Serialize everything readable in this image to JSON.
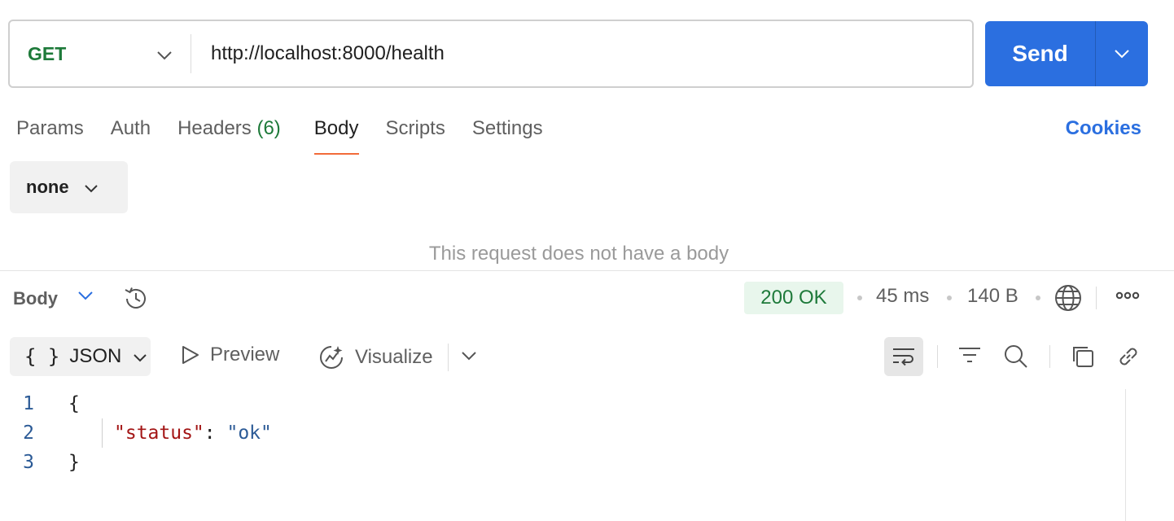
{
  "request": {
    "method": "GET",
    "url": "http://localhost:8000/health",
    "send_label": "Send"
  },
  "request_tabs": [
    {
      "label": "Params"
    },
    {
      "label": "Auth"
    },
    {
      "label": "Headers",
      "count": "(6)"
    },
    {
      "label": "Body"
    },
    {
      "label": "Scripts"
    },
    {
      "label": "Settings"
    }
  ],
  "active_request_tab": "Body",
  "cookies_label": "Cookies",
  "body_mode": "none",
  "empty_body_message": "This request does not have a body",
  "response": {
    "section_label": "Body",
    "status": "200 OK",
    "time": "45 ms",
    "size": "140 B",
    "format": "JSON",
    "format_icon": "{ }",
    "preview_label": "Preview",
    "visualize_label": "Visualize",
    "lines": [
      {
        "num": "1",
        "text": "{"
      },
      {
        "num": "2",
        "key": "\"status\"",
        "sep": ": ",
        "value": "\"ok\""
      },
      {
        "num": "3",
        "text": "}"
      }
    ]
  },
  "colors": {
    "accent": "#2b6fe0",
    "method_get": "#1e7a3a",
    "active_tab_underline": "#f26b3a",
    "status_ok_bg": "#e8f6ec"
  }
}
